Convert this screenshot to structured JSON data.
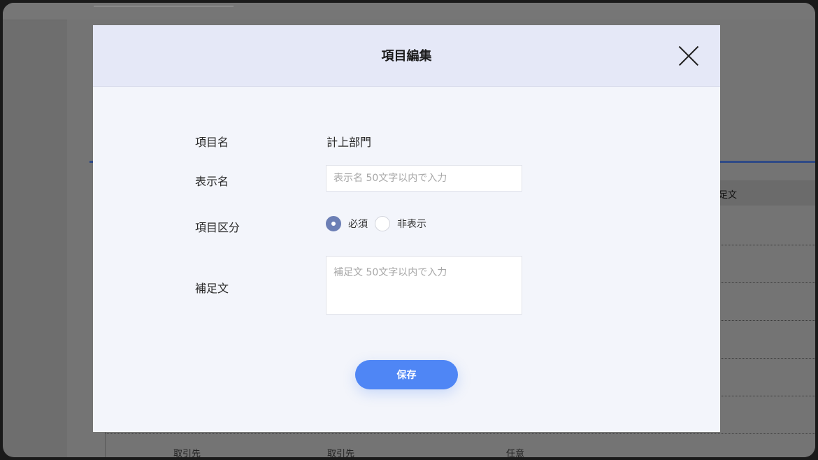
{
  "modal": {
    "title": "項目編集",
    "fields": {
      "item_name_label": "項目名",
      "item_name_value": "計上部門",
      "display_name_label": "表示名",
      "display_name_placeholder": "表示名 50文字以内で入力",
      "display_name_value": "",
      "category_label": "項目区分",
      "category_options": [
        {
          "label": "必須",
          "selected": true
        },
        {
          "label": "非表示",
          "selected": false
        }
      ],
      "note_label": "補足文",
      "note_placeholder": "補足文 50文字以内で入力",
      "note_value": ""
    },
    "save_label": "保存",
    "close_icon": "close-icon"
  },
  "background": {
    "column_header": "足文",
    "row": [
      "取引先",
      "取引先",
      "任意"
    ]
  },
  "colors": {
    "header_bg": "#e5e8f7",
    "primary_button": "#4f86f5",
    "radio_checked": "#6c7fb5",
    "overlay": "#6e6e6e"
  }
}
